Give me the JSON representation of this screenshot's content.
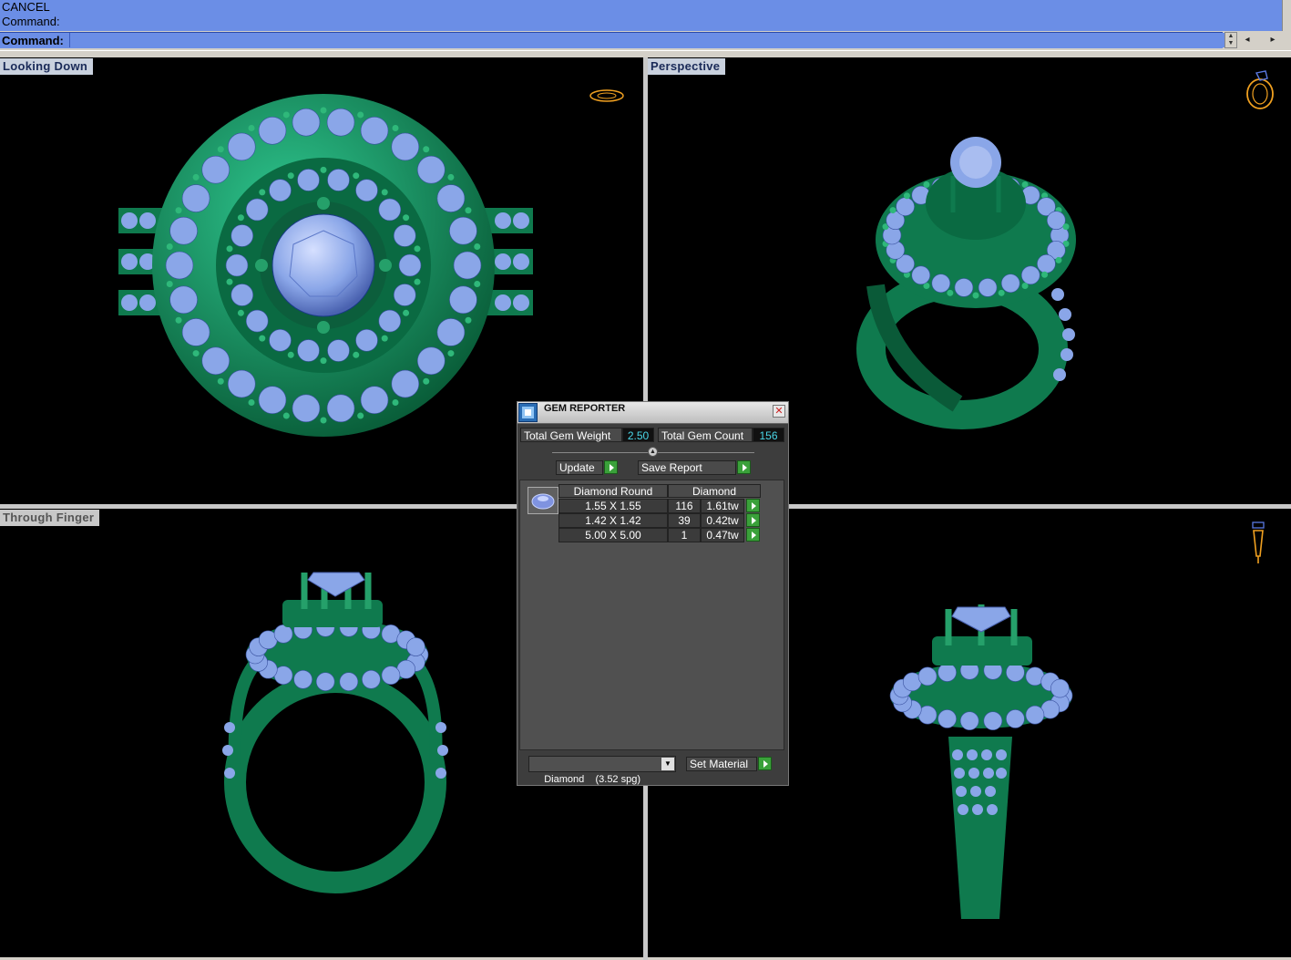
{
  "command_area": {
    "history": [
      "CANCEL",
      "Command:"
    ],
    "prompt_label": "Command:",
    "input_value": ""
  },
  "viewports": {
    "top_left": {
      "label": "Looking Down"
    },
    "top_right": {
      "label": "Perspective"
    },
    "bottom_left": {
      "label": "Through Finger"
    },
    "bottom_right": {
      "label": ""
    }
  },
  "gem_reporter": {
    "title": "GEM REPORTER",
    "total_weight_label": "Total Gem Weight",
    "total_weight_value": "2.50",
    "total_count_label": "Total Gem Count",
    "total_count_value": "156",
    "update_label": "Update",
    "save_report_label": "Save Report",
    "table": {
      "headers": [
        "Diamond Round",
        "Diamond"
      ],
      "rows": [
        {
          "size": "1.55 X 1.55",
          "count": "116",
          "weight": "1.61tw"
        },
        {
          "size": "1.42 X 1.42",
          "count": "39",
          "weight": "0.42tw"
        },
        {
          "size": "5.00 X 5.00",
          "count": "1",
          "weight": "0.47tw"
        }
      ]
    },
    "material_selected": "Diamond    (3.52 spg)",
    "set_material_label": "Set Material"
  },
  "colors": {
    "command_bg": "#6b8ee6",
    "metal_green": "#0f7a4e",
    "gem_blue": "#8aa6e8",
    "orientation_orange": "#f0a020"
  }
}
